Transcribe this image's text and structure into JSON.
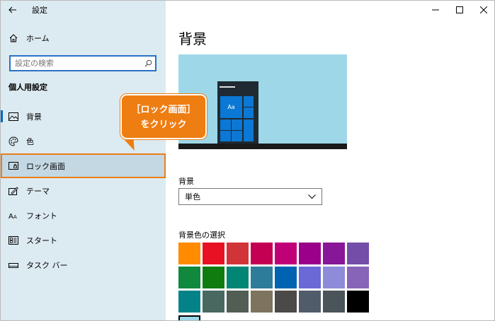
{
  "app": {
    "title": "設定"
  },
  "sidebar": {
    "home_label": "ホーム",
    "search": {
      "placeholder": "設定の検索"
    },
    "section_heading": "個人用設定",
    "items": [
      {
        "label": "背景",
        "icon": "image-icon"
      },
      {
        "label": "色",
        "icon": "palette-icon"
      },
      {
        "label": "ロック画面",
        "icon": "lock-screen-icon"
      },
      {
        "label": "テーマ",
        "icon": "theme-icon"
      },
      {
        "label": "フォント",
        "icon": "font-icon"
      },
      {
        "label": "スタート",
        "icon": "start-icon"
      },
      {
        "label": "タスク バー",
        "icon": "taskbar-icon"
      }
    ]
  },
  "content": {
    "page_title": "背景",
    "preview_tile_text": "Aa",
    "background_label": "背景",
    "background_value": "単色",
    "color_section_label": "背景色の選択",
    "swatch_colors": [
      "#ff8c00",
      "#e81123",
      "#d13438",
      "#c30052",
      "#bf0077",
      "#9a0089",
      "#881798",
      "#744da9",
      "#10893e",
      "#107c10",
      "#018574",
      "#2d7d9a",
      "#0063b1",
      "#6b69d6",
      "#8e8cd8",
      "#8764b8",
      "#038387",
      "#486860",
      "#525e54",
      "#7e735f",
      "#4c4a48",
      "#515c6b",
      "#4a5459",
      "#000000"
    ],
    "selected_color": "#9ed8e8"
  },
  "callout": {
    "line1": "［ロック画面］",
    "line2": "をクリック"
  },
  "colors": {
    "accent": "#0067c0",
    "sidebar_bg": "#dceaf1",
    "callout": "#ee7d12"
  }
}
